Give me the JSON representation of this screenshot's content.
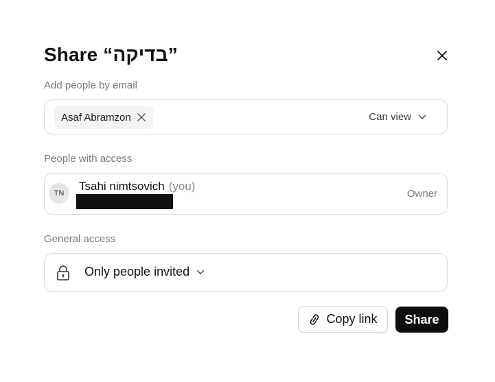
{
  "dialog": {
    "title": "Share “בדיקה”"
  },
  "add_people": {
    "label": "Add people by email",
    "chip_name": "Asaf Abramzon",
    "permission": "Can view"
  },
  "people_access": {
    "label": "People with access",
    "avatar_initials": "TN",
    "name": "Tsahi nimtsovich",
    "you_tag": "(you)",
    "role": "Owner"
  },
  "general_access": {
    "label": "General access",
    "value": "Only people invited"
  },
  "actions": {
    "copy_link": "Copy link",
    "share": "Share"
  },
  "icons": [
    "close-icon",
    "remove-chip-icon",
    "chevron-down-icon",
    "lock-icon",
    "link-icon"
  ],
  "colors": {
    "primary_button": "#0d0d0d",
    "border": "#dcdcdc",
    "muted_text": "#7a7a7a"
  }
}
